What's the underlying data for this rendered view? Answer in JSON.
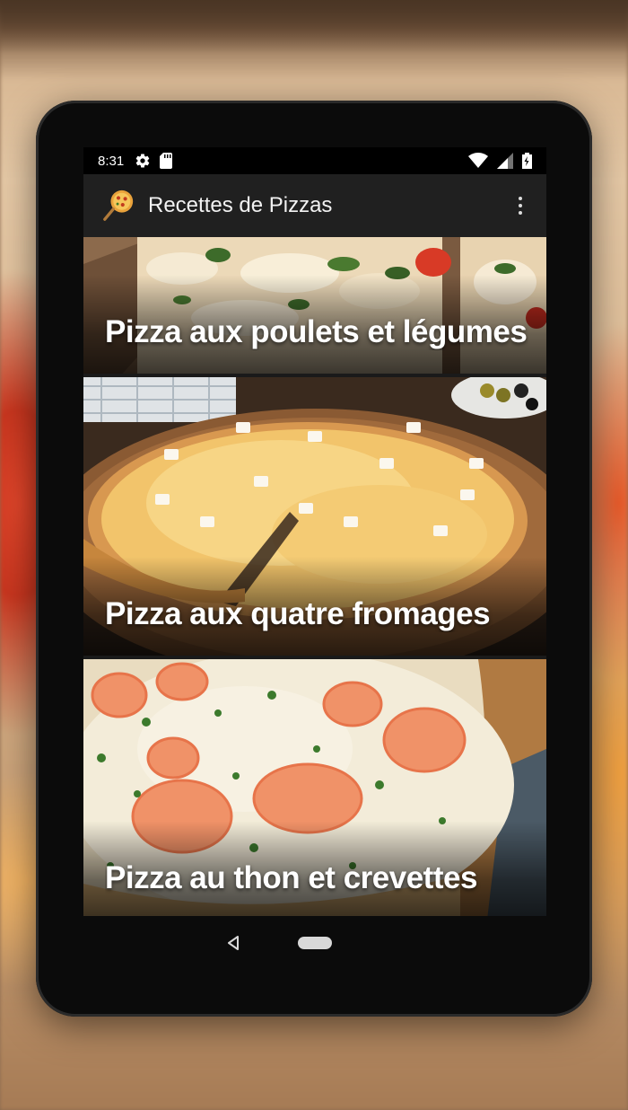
{
  "status_bar": {
    "time": "8:31",
    "icons": [
      "settings-icon",
      "sd-card-icon",
      "wifi-icon",
      "cell-signal-icon",
      "battery-charging-icon"
    ]
  },
  "app_bar": {
    "title": "Recettes de Pizzas",
    "logo": "pizza-logo-icon",
    "menu_icon": "more-vert-icon"
  },
  "recipes": [
    {
      "title": "Pizza aux poulets et légumes",
      "image": "pizza-chicken-vegetables"
    },
    {
      "title": "Pizza aux quatre fromages",
      "image": "pizza-four-cheese"
    },
    {
      "title": "Pizza au thon et crevettes",
      "image": "pizza-tuna-shrimp"
    }
  ],
  "nav_bar": {
    "back_icon": "back-triangle-icon",
    "home_icon": "home-pill-icon"
  },
  "colors": {
    "app_bar_bg": "#202020",
    "status_bar_bg": "#000000",
    "device_bezel": "#0b0b0b",
    "label_text": "#ffffff"
  }
}
